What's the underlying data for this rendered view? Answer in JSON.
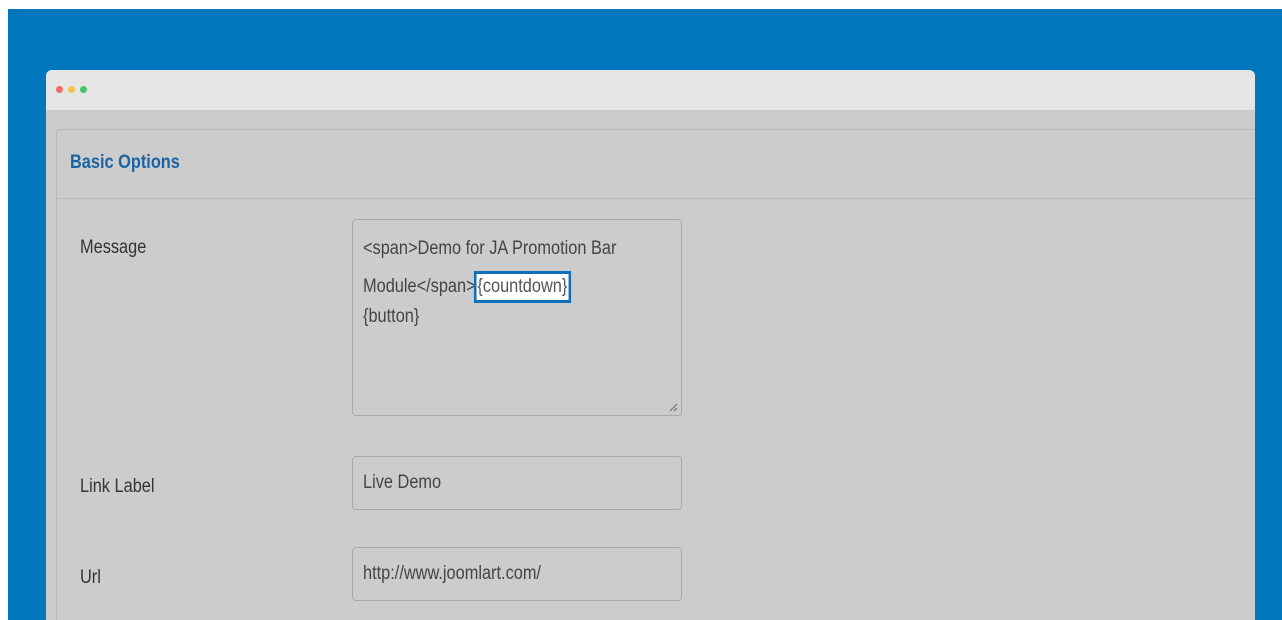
{
  "panel": {
    "title": "Basic Options"
  },
  "fields": {
    "message": {
      "label": "Message",
      "line1": "<span>Demo for JA Promotion Bar",
      "line2_prefix": "Module</span>",
      "line2_token": "{countdown}",
      "line3": "{button}"
    },
    "link_label": {
      "label": "Link Label",
      "value": "Live Demo"
    },
    "url": {
      "label": "Url",
      "value": "http://www.joomlart.com/"
    }
  },
  "colors": {
    "frame": "#0277bd",
    "title": "#1a64a5",
    "highlight_border": "#0f6fb8"
  }
}
